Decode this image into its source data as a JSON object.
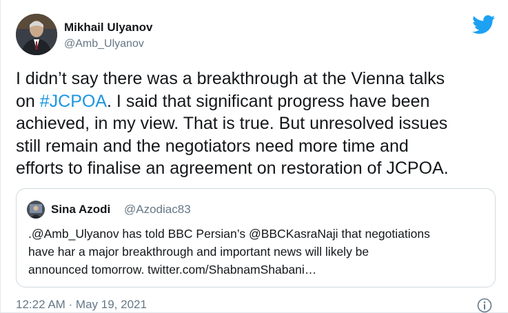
{
  "author": {
    "name": "Mikhail Ulyanov",
    "handle": "@Amb_Ulyanov"
  },
  "tweet": {
    "line1": "I didn’t say there was a breakthrough at the Vienna talks",
    "prefix2": "on ",
    "hashtag": "#JCPOA",
    "suffix2": ". I said that significant progress have been",
    "line3": "achieved, in my view. That is true. But unresolved issues",
    "line4": "still remain and the negotiators need more time and",
    "line5": "efforts to finalise an agreement on restoration of JCPOA."
  },
  "quoted": {
    "name": "Sina Azodi",
    "handle": "@Azodiac83",
    "line1": ".@Amb_Ulyanov has told BBC Persian’s @BBCKasraNaji that negotiations",
    "line2": "have har a major breakthrough and important news will likely be",
    "line3": "announced tomorrow. twitter.com/ShabnamShabani…"
  },
  "footer": {
    "timestamp": "12:22 AM · May 19, 2021"
  },
  "colors": {
    "twitter_blue": "#1da1f2",
    "hashtag_blue": "#1b95e0",
    "secondary_text": "#657786"
  },
  "icons": {
    "brand": "twitter-bird-icon",
    "info": "info-icon"
  }
}
